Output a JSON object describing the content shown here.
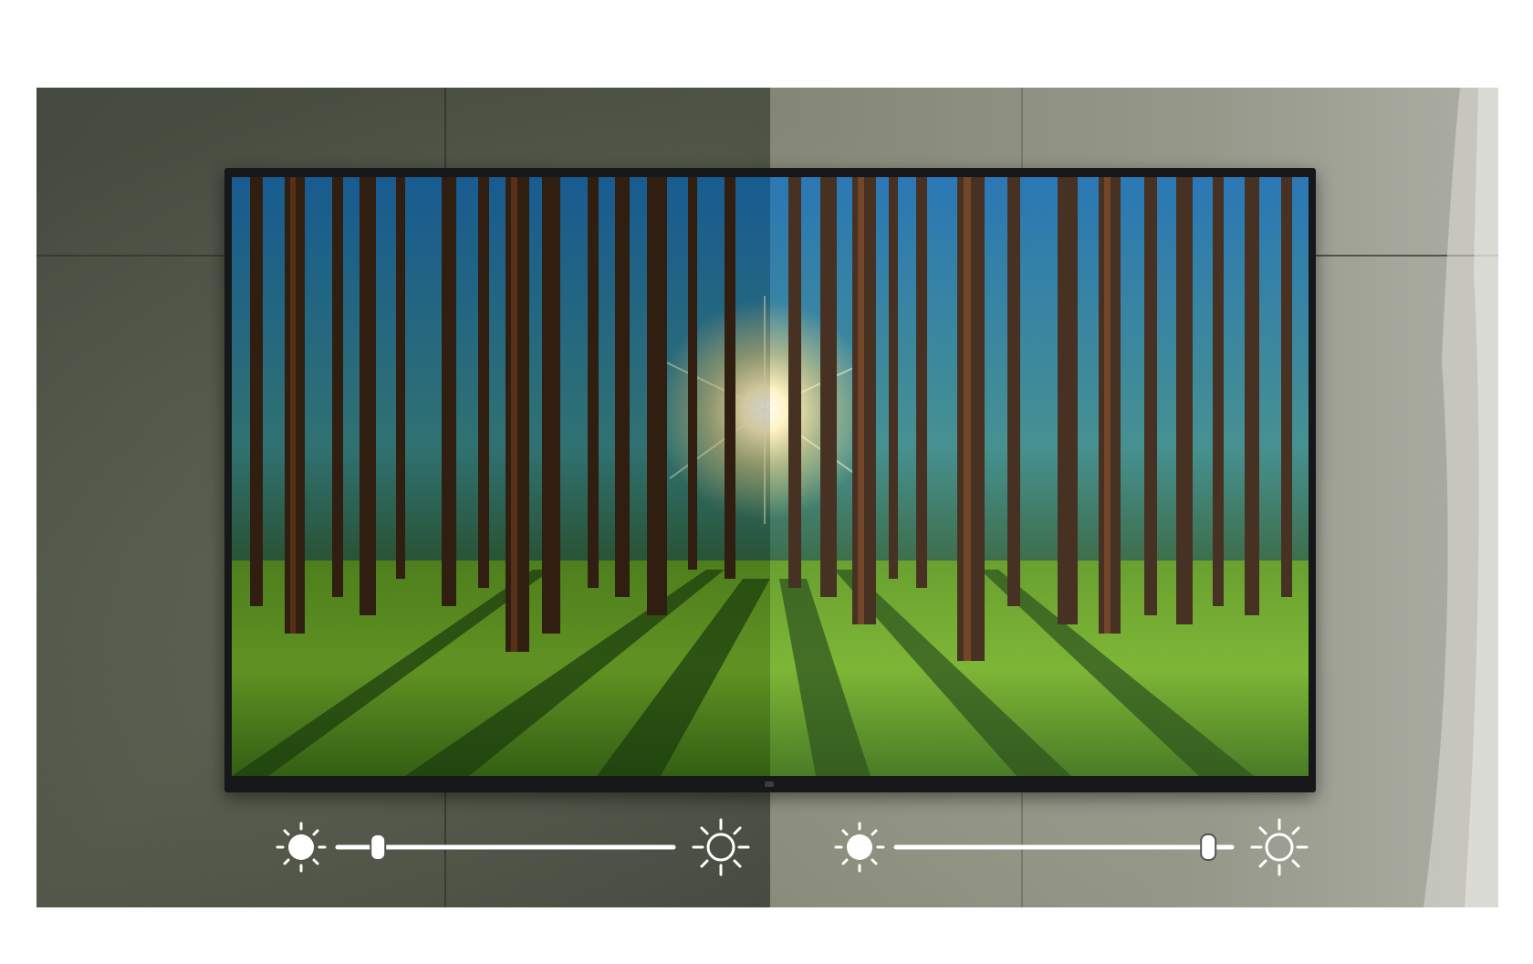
{
  "scene": {
    "subject": "tv-on-concrete-wall-forest-screen",
    "colors": {
      "wall_left": "#4f5546",
      "wall_right": "#9ea091",
      "tv_frame": "#151718",
      "slider": "#ffffff"
    }
  },
  "brightness_controls": [
    {
      "name": "dim-side",
      "min_icon": "sun-filled-icon",
      "max_icon": "sun-outline-icon",
      "level": 0.12
    },
    {
      "name": "bright-side",
      "min_icon": "sun-filled-icon",
      "max_icon": "sun-outline-icon",
      "level": 0.93
    }
  ]
}
